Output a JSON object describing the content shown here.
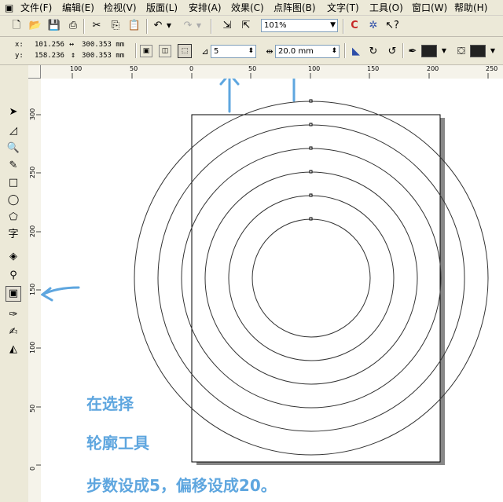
{
  "menu": {
    "items": [
      "文件(F)",
      "编辑(E)",
      "检视(V)",
      "版面(L)",
      "安排(A)",
      "效果(C)",
      "点阵图(B)",
      "文字(T)",
      "工具(O)",
      "窗口(W)",
      "帮助(H)"
    ]
  },
  "toolbar": {
    "zoom_value": "101%"
  },
  "property_bar": {
    "x_label": "x:",
    "x_value": "101.256",
    "y_label": "y:",
    "y_value": "158.236",
    "width_value": "300.353 mm",
    "height_value": "300.353 mm",
    "steps_value": "5",
    "offset_value": "20.0 mm"
  },
  "ruler_top": {
    "ticks": [
      "100",
      "50",
      "0",
      "50",
      "100",
      "150",
      "200",
      "250"
    ]
  },
  "ruler_left": {
    "ticks": [
      "300",
      "250",
      "200",
      "150",
      "100",
      "50",
      "0"
    ]
  },
  "annotation": {
    "line1": "在选择",
    "line2": "轮廓工具",
    "line3": "步数设成5，偏移设成20。",
    "color": "#5ea6df"
  }
}
